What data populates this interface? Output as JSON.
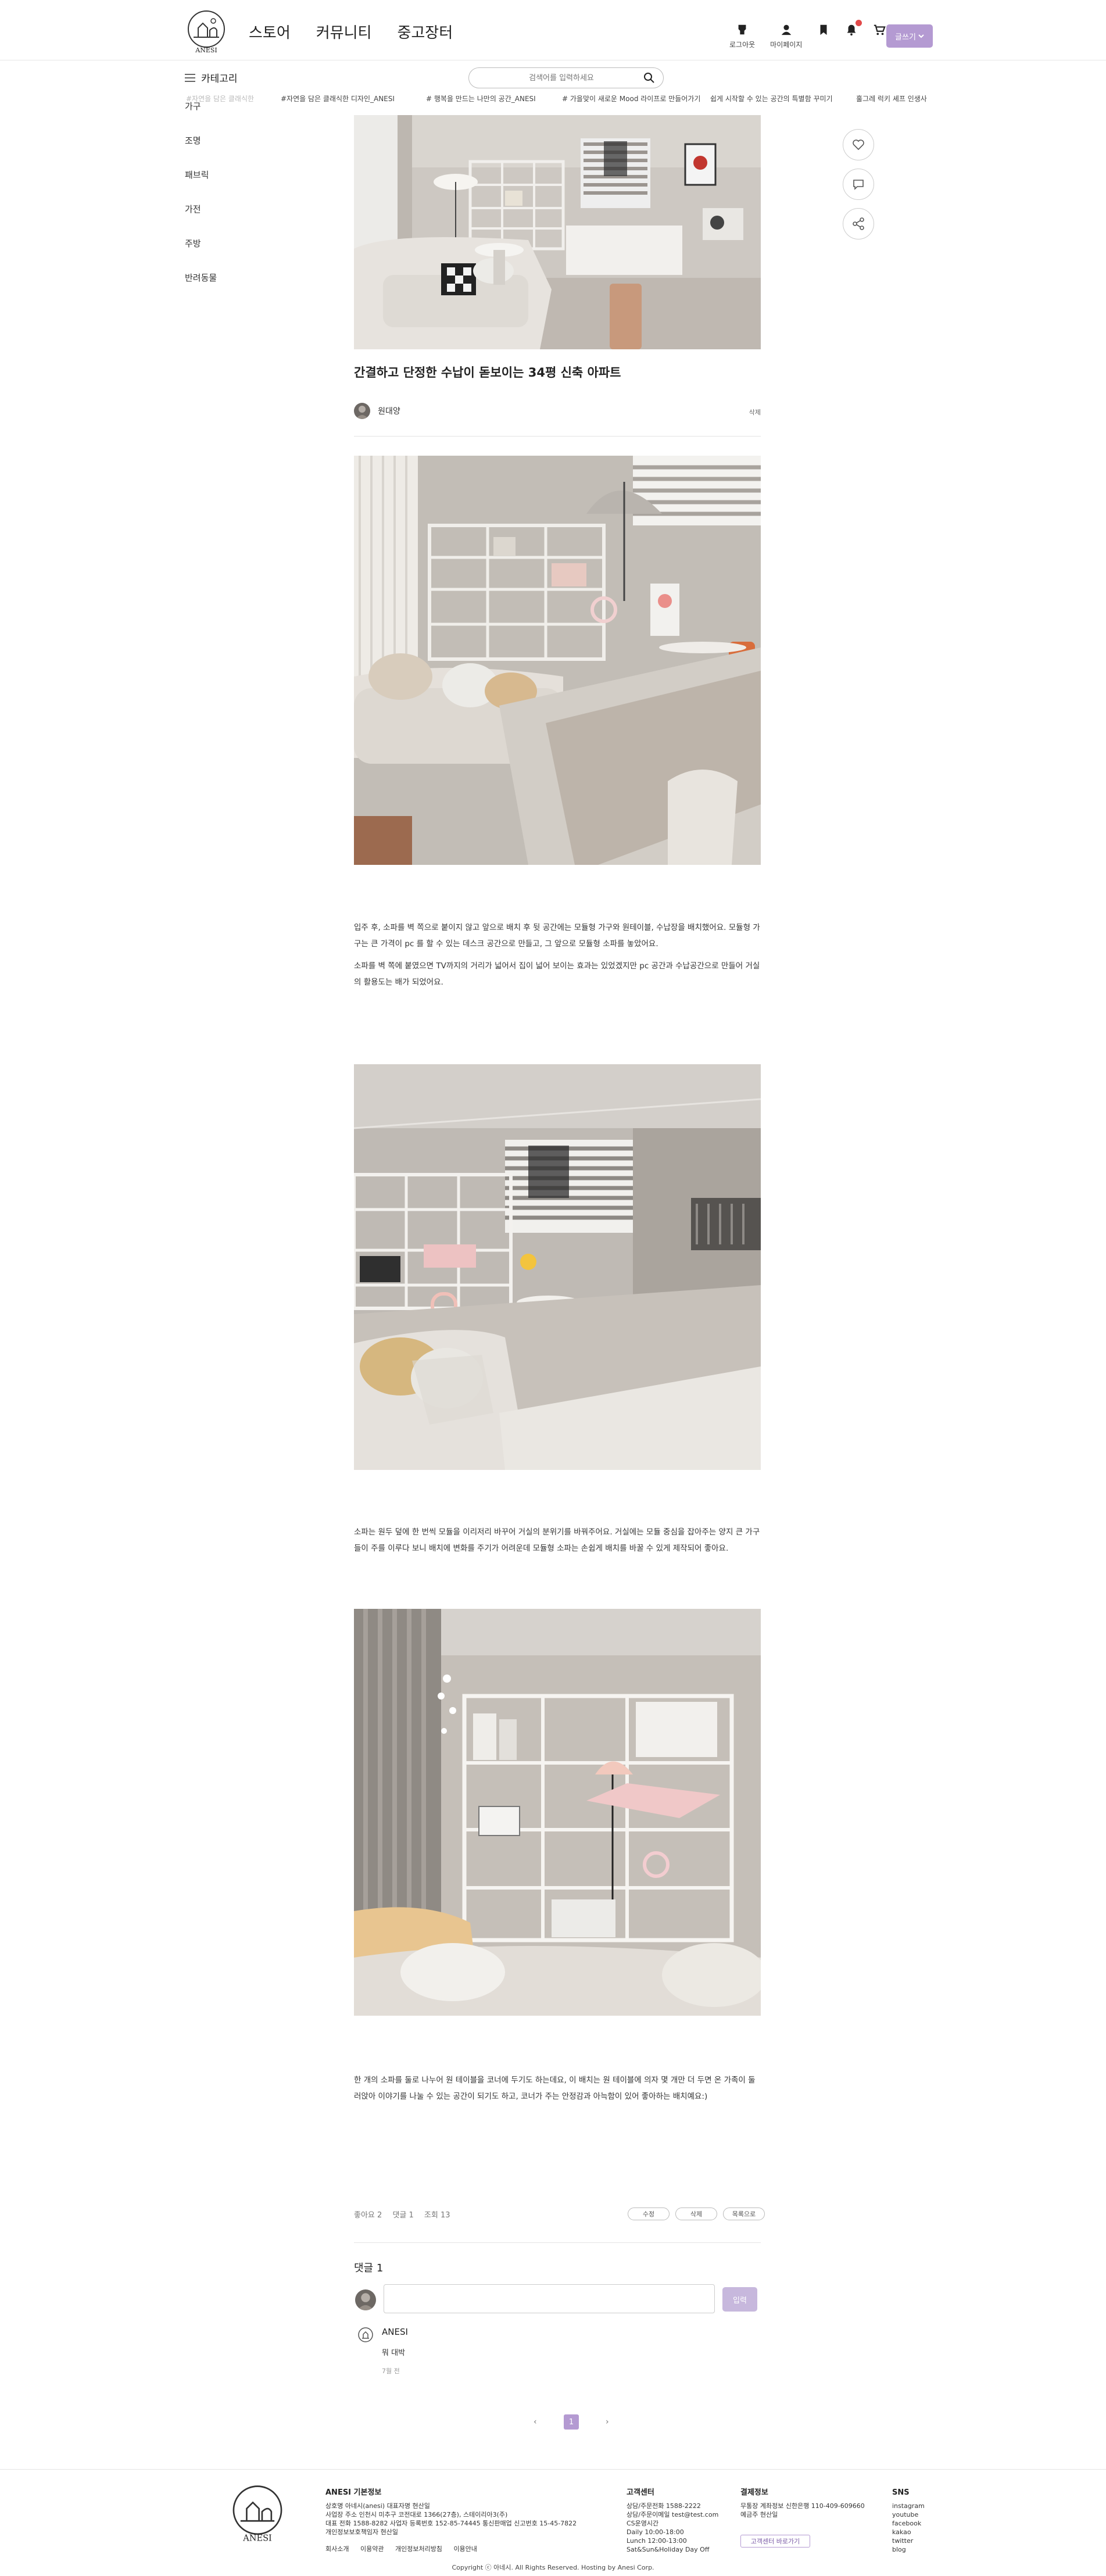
{
  "brand": {
    "name": "ANESI"
  },
  "nav": {
    "items": [
      "스토어",
      "커뮤니티",
      "중고장터"
    ]
  },
  "util": {
    "logout": "로그아웃",
    "mypage": "마이페이지"
  },
  "write_button": "글쓰기",
  "category_toggle": "카테고리",
  "search": {
    "placeholder": "검색어를 입력하세요"
  },
  "ticker": [
    "#자연을 담은 클래식한 디자인_ANESI",
    "# 행복을 만드는 나만의 공간_ANESI",
    "# 가을맞이 새로운 Mood 라이프로 만들어가기",
    "쉽게 시작할 수 있는 공간의 특별함 꾸미기",
    "훌그레 럭키 셰프 인생사"
  ],
  "sidebar": {
    "items": [
      "가구",
      "조명",
      "패브릭",
      "가전",
      "주방",
      "반려동물"
    ]
  },
  "post": {
    "title": "간결하고 단정한 수납이 돋보이는 34평 신축 아파트",
    "author": "원대양",
    "delete": "삭제",
    "paragraphs": [
      "입주 후, 소파를 벽 쪽으로 붙이지 않고 앞으로 배치 후 뒷 공간에는 모듈형 가구와 원테이블, 수납장을 배치했어요. 모듈형 가구는 큰 가격이 pc 를 할 수 있는 데스크 공간으로 만들고, 그 앞으로 모듈형 소파를 놓았어요.",
      "소파를 벽 쪽에 붙였으면 TV까지의 거리가 넓어서 집이 넓어 보이는 효과는 있었겠지만 pc 공간과 수납공간으로 만들어 거실의 활용도는 배가 되었어요.",
      "소파는 원두 덮에 한 번씩 모듈을 이리저리 바꾸어 거실의 분위기를 바꿔주어요. 거실에는 모듈 중심을 잡아주는 양지 큰 가구들이 주를 이루다 보니 배치에 변화를 주기가 어려운데 모듈형 소파는 손쉽게 배치를 바꿀 수 있게 제작되어 좋아요.",
      "한 개의 소파를 둘로 나누어 원 테이블을 코너에 두기도 하는데요, 이 배치는 원 테이블에 의자 몇 개만 더 두면 온 가족이 둘러앉아 이야기를 나눌 수 있는 공간이 되기도 하고, 코너가 주는 안정감과 아늑함이 있어 좋아하는 배치예요:)"
    ],
    "stats": {
      "likes": "좋아요 2",
      "comments": "댓글 1",
      "views": "조회 13"
    },
    "actions": {
      "edit": "수정",
      "delete": "삭제",
      "list": "목록으로"
    }
  },
  "comments": {
    "title": "댓글 1",
    "input_placeholder": "",
    "submit": "입력",
    "items": [
      {
        "name": "ANESI",
        "text": "뭐 대박",
        "meta": "7월 전"
      }
    ]
  },
  "pagination": {
    "prev": "‹",
    "current": "1",
    "next": "›"
  },
  "footer": {
    "company": {
      "heading": "ANESI 기본정보",
      "lines": [
        "상호명 아네시(anesi) 대표자명 현산일",
        "사업장 주소 인천시 미추구 코전대로 1366(27층), 스테이리아3(주)",
        "대표 전화 1588-8282 사업자 등록번호 152-85-74445 통신판매업 신고번호 15-45-7822",
        "개인정보보호책임자 현산일"
      ]
    },
    "links": [
      "회사소개",
      "이용약관",
      "개인정보처리방침",
      "이용안내"
    ],
    "cs": {
      "heading": "고객센터",
      "lines": [
        "상담/주문전화 1588-2222",
        "상담/주문이메일 test@test.com",
        "CS운영시간",
        "Daily 10:00-18:00",
        "Lunch 12:00-13:00",
        "Sat&Sun&Holiday Day Off"
      ]
    },
    "payment": {
      "heading": "결제정보",
      "lines": [
        "무통장 계좌정보 신한은행 110-409-609660",
        "예금주 현산일"
      ],
      "button": "고객센터 바로가기"
    },
    "sns": {
      "heading": "SNS",
      "items": [
        "instagram",
        "youtube",
        "facebook",
        "kakao",
        "twitter",
        "blog"
      ]
    },
    "copyright": "Copyright ⓒ 아네시. All Rights Reserved. Hosting by Anesi Corp."
  },
  "colors": {
    "accent": "#b49ad2",
    "notify": "#e24a4a"
  }
}
